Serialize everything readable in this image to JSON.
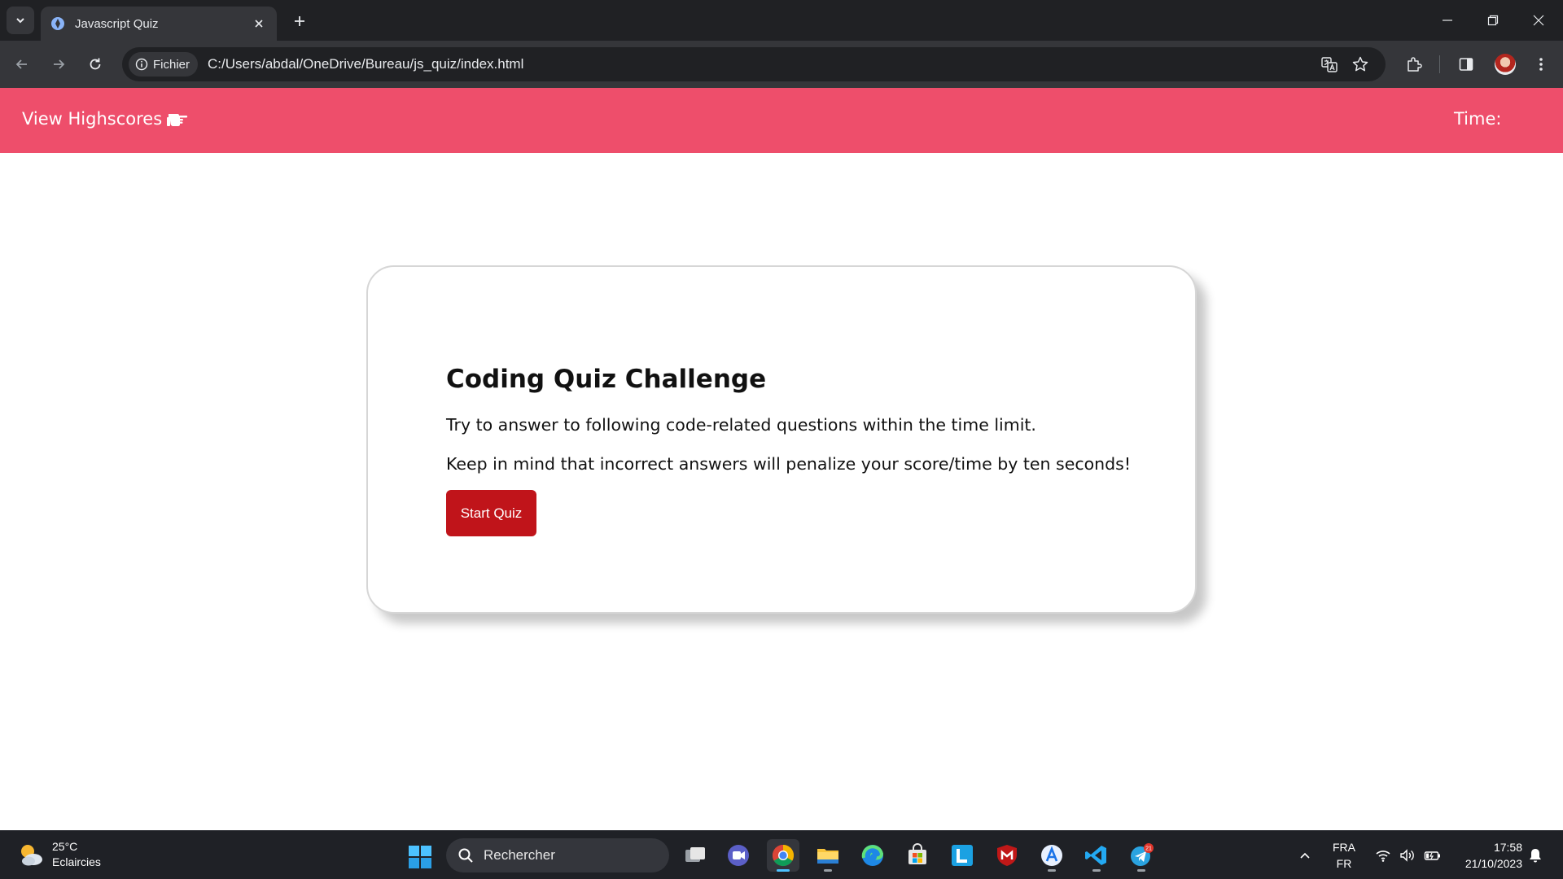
{
  "browser": {
    "tab_title": "Javascript Quiz",
    "site_chip": "Fichier",
    "url": "C:/Users/abdal/OneDrive/Bureau/js_quiz/index.html"
  },
  "header": {
    "highscores_label": "View Highscores",
    "highscores_icon": "pointing-hand-icon",
    "timer_label": "Time:"
  },
  "quiz": {
    "title": "Coding Quiz Challenge",
    "instructions": "Try to answer to following code-related questions within the time limit.",
    "warning": "Keep in mind that incorrect answers will penalize your score/time by ten seconds!",
    "start_label": "Start Quiz"
  },
  "taskbar": {
    "weather_temp": "25°C",
    "weather_desc": "Eclaircies",
    "search_placeholder": "Rechercher",
    "telegram_badge": "21",
    "lang_primary": "FRA",
    "lang_secondary": "FR",
    "time": "17:58",
    "date": "21/10/2023"
  },
  "colors": {
    "header_bg": "#ee4e6b",
    "start_button": "#c0141a",
    "chrome_dark": "#202124"
  }
}
